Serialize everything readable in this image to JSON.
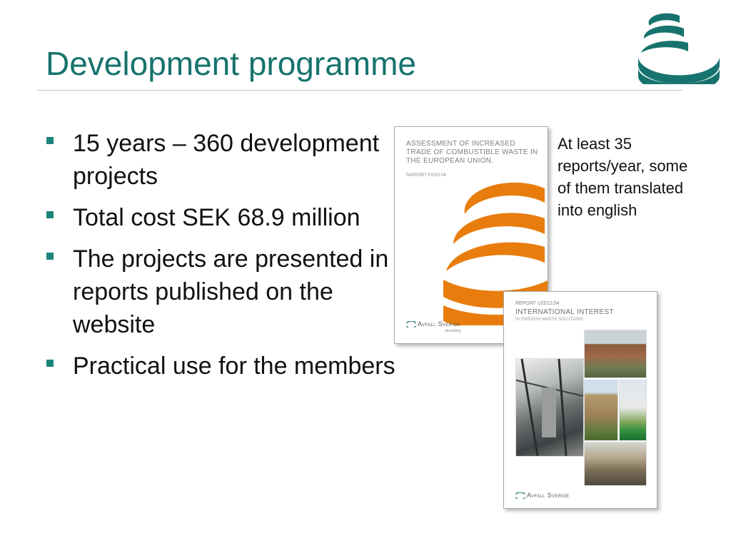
{
  "slide": {
    "title": "Development programme",
    "bullets": [
      "15 years – 360 development projects",
      "Total cost SEK 68.9 million",
      "The projects are presented in reports published on the website",
      "Practical use for the members"
    ],
    "side_note": "At least 35 reports/year, some of them translated into english"
  },
  "report_covers": [
    {
      "title": "ASSESSMENT OF INCREASED TRADE OF COMBUSTIBLE WASTE IN THE EUROPEAN UNION.",
      "code": "RAPPORT F2012:04",
      "publisher": "Avfall Sverige",
      "publisher_sub": "utveckling"
    },
    {
      "code": "REPORT U2012:04",
      "title": "INTERNATIONAL INTEREST",
      "subtitle": "IN SWEDISH WASTE SOLUTIONS",
      "publisher": "Avfall Sverige"
    }
  ],
  "colors": {
    "title": "#17736d",
    "bullet_marker": "#1d847c",
    "logo": "#17736d",
    "cover_swoosh": "#e87d0d",
    "text": "#111111"
  },
  "icons": {
    "logo": "avfall-sverige-swoosh-logo",
    "bullet": "square-bullet"
  }
}
